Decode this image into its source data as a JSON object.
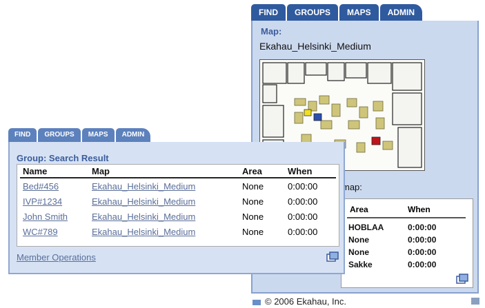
{
  "back_panel": {
    "tabs": [
      "FIND",
      "GROUPS",
      "MAPS",
      "ADMIN"
    ],
    "map_heading": "Map:",
    "map_name": "Ekahau_Helsinki_Medium",
    "on_map_label": "map:",
    "area_table": {
      "headers": [
        "Area",
        "When"
      ],
      "rows": [
        {
          "area": "HOBLAA",
          "when": "0:00:00"
        },
        {
          "area": "None",
          "when": "0:00:00"
        },
        {
          "area": "None",
          "when": "0:00:00"
        },
        {
          "area": "Sakke",
          "when": "0:00:00"
        }
      ]
    }
  },
  "front_panel": {
    "tabs": [
      "FIND",
      "GROUPS",
      "MAPS",
      "ADMIN"
    ],
    "title": "Group: Search Result",
    "table": {
      "headers": [
        "Name",
        "Map",
        "Area",
        "When"
      ],
      "rows": [
        {
          "name": "Bed#456",
          "map": "Ekahau_Helsinki_Medium",
          "area": "None",
          "when": "0:00:00"
        },
        {
          "name": "IVP#1234",
          "map": "Ekahau_Helsinki_Medium",
          "area": "None",
          "when": "0:00:00"
        },
        {
          "name": "John Smith",
          "map": "Ekahau_Helsinki_Medium",
          "area": "None",
          "when": "0:00:00"
        },
        {
          "name": "WC#789",
          "map": "Ekahau_Helsinki_Medium",
          "area": "None",
          "when": "0:00:00"
        }
      ]
    },
    "member_operations": "Member Operations"
  },
  "footer": "© 2006 Ekahau, Inc.",
  "icons": {
    "dock": "dock-icon",
    "footer": "ekahau-footer-icon",
    "resize": "resize-corner-icon"
  },
  "colors": {
    "tab_blue": "#2f5a9e",
    "panel_back": "#cbd9ef",
    "panel_front": "#d6e2f4",
    "heading": "#3b5c9b",
    "link": "#5a6e99",
    "marker_yellow": "#f0e020",
    "marker_blue": "#2b4fae",
    "marker_red": "#c0141c"
  }
}
